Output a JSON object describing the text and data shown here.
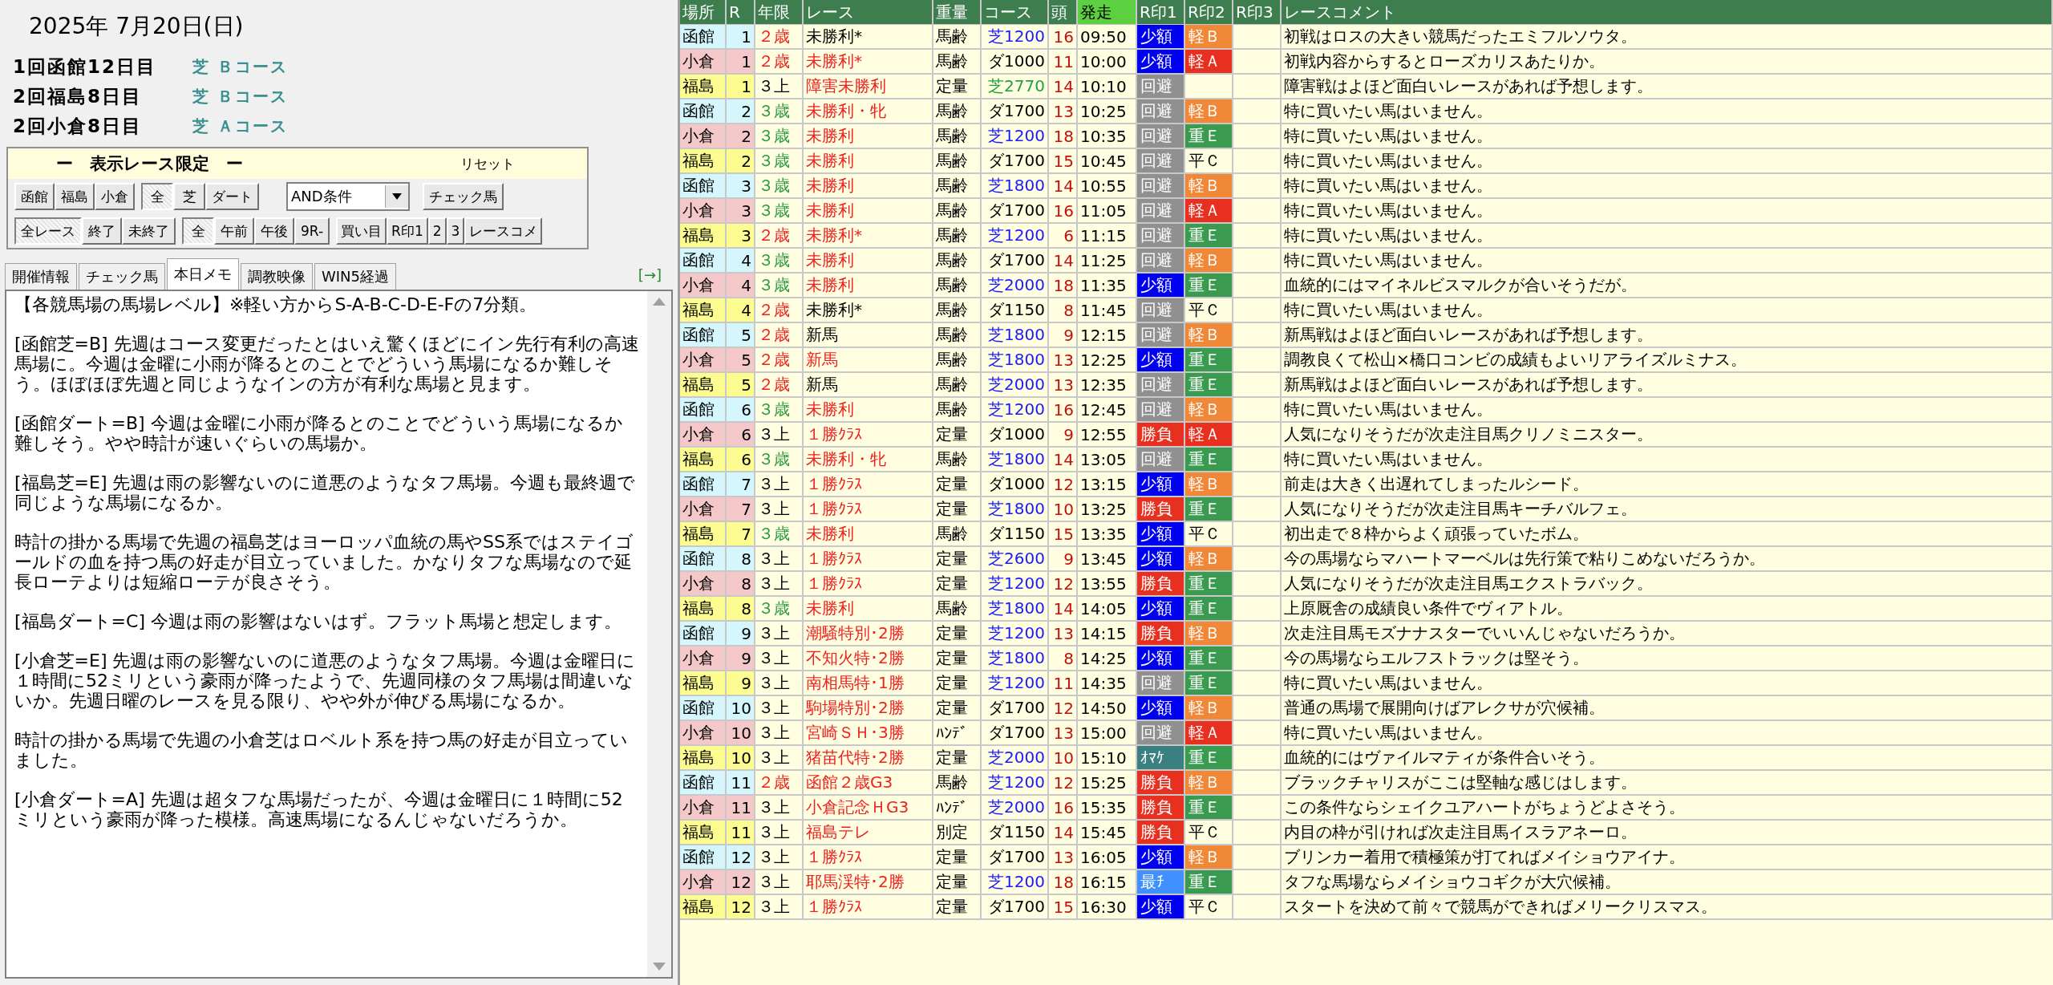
{
  "date": "2025年 7月20日(日)",
  "meetings": [
    {
      "label": "1回函館12日目",
      "course": "芝 Ｂコース"
    },
    {
      "label": "2回福島8日目",
      "course": "芝 Ｂコース"
    },
    {
      "label": "2回小倉8日目",
      "course": "芝 Ａコース"
    }
  ],
  "filter": {
    "title": "ー　表示レース限定　ー",
    "reset": "リセット",
    "row1": [
      [
        {
          "label": "函館",
          "selected": false
        },
        {
          "label": "福島",
          "selected": false
        },
        {
          "label": "小倉",
          "selected": false
        }
      ],
      [
        {
          "label": "全",
          "selected": true
        },
        {
          "label": "芝",
          "selected": false
        },
        {
          "label": "ダート",
          "selected": false
        }
      ]
    ],
    "condition": "AND条件",
    "check_button": "チェック馬",
    "row2": [
      [
        {
          "label": "全レース",
          "selected": true
        },
        {
          "label": "終了",
          "selected": false
        },
        {
          "label": "未終了",
          "selected": false
        }
      ],
      [
        {
          "label": "全",
          "selected": true
        },
        {
          "label": "午前",
          "selected": false
        },
        {
          "label": "午後",
          "selected": false
        },
        {
          "label": "9R-",
          "selected": false
        }
      ]
    ],
    "row2_buttons": [
      "買い目",
      "R印1",
      "2",
      "3",
      "レースコメ"
    ]
  },
  "tabs": [
    {
      "label": "開催情報",
      "selected": false
    },
    {
      "label": "チェック馬",
      "selected": false
    },
    {
      "label": "本日メモ",
      "selected": true
    },
    {
      "label": "調教映像",
      "selected": false
    },
    {
      "label": "WIN5経過",
      "selected": false
    }
  ],
  "expand_link": "[→]",
  "memo": [
    "【各競馬場の馬場レベル】※軽い方からS-A-B-C-D-E-Fの7分類。",
    "[函館芝=B] 先週はコース変更だったとはいえ驚くほどにイン先行有利の高速馬場に。今週は金曜に小雨が降るとのことでどういう馬場になるか難しそう。ほぼほぼ先週と同じようなインの方が有利な馬場と見ます。",
    "[函館ダート=B] 今週は金曜に小雨が降るとのことでどういう馬場になるか難しそう。やや時計が速いぐらいの馬場か。",
    "[福島芝=E] 先週は雨の影響ないのに道悪のようなタフ馬場。今週も最終週で同じような馬場になるか。",
    "時計の掛かる馬場で先週の福島芝はヨーロッパ血統の馬やSS系ではステイゴールドの血を持つ馬の好走が目立っていました。かなりタフな馬場なので延長ローテよりは短縮ローテが良さそう。",
    "[福島ダート=C] 今週は雨の影響はないはず。フラット馬場と想定します。",
    "[小倉芝=E] 先週は雨の影響ないのに道悪のようなタフ馬場。今週は金曜日に１時間に52ミリという豪雨が降ったようで、先週同様のタフ馬場は間違いないか。先週日曜のレースを見る限り、やや外が伸びる馬場になるか。",
    "時計の掛かる馬場で先週の小倉芝はロベルト系を持つ馬の好走が目立っていました。",
    "[小倉ダート=A] 先週は超タフな馬場だったが、今週は金曜日に１時間に52ミリという豪雨が降った模様。高速馬場になるんじゃないだろうか。"
  ],
  "table": {
    "columns": [
      {
        "label": "場所",
        "selected": false
      },
      {
        "label": "R",
        "selected": false
      },
      {
        "label": "年限",
        "selected": false
      },
      {
        "label": "レース",
        "selected": false
      },
      {
        "label": "重量",
        "selected": false
      },
      {
        "label": "コース",
        "selected": false
      },
      {
        "label": "頭",
        "selected": false
      },
      {
        "label": "発走",
        "selected": true
      },
      {
        "label": "R印1",
        "selected": false
      },
      {
        "label": "R印2",
        "selected": false
      },
      {
        "label": "R印3",
        "selected": false
      },
      {
        "label": "レースコメント",
        "selected": false
      }
    ],
    "rows": [
      {
        "venue": {
          "text": "函館",
          "color": "#d4f6fc"
        },
        "r": "1",
        "age": {
          "text": "２歳",
          "color": "#ee2020"
        },
        "race": {
          "text": "未勝利*",
          "color": "#000000"
        },
        "weight": "馬齢",
        "course": {
          "text": "芝1200",
          "color": "#1a1aff"
        },
        "heads": "16",
        "time": "09:50",
        "mark1": {
          "text": "少額",
          "color": "#0000f0"
        },
        "mark2": {
          "text": "軽Ｂ",
          "color": "#f08838"
        },
        "comment": "初戦はロスの大きい競馬だったエミフルソウタ。"
      },
      {
        "venue": {
          "text": "小倉",
          "color": "#f4c8c8"
        },
        "r": "1",
        "age": {
          "text": "２歳",
          "color": "#ee2020"
        },
        "race": {
          "text": "未勝利*",
          "color": "#ee2020"
        },
        "weight": "馬齢",
        "course": {
          "text": "ダ1000",
          "color": "#000000"
        },
        "heads": "11",
        "time": "10:00",
        "mark1": {
          "text": "少額",
          "color": "#0000f0"
        },
        "mark2": {
          "text": "軽Ａ",
          "color": "#e83020"
        },
        "comment": "初戦内容からするとローズカリスあたりか。"
      },
      {
        "venue": {
          "text": "福島",
          "color": "#fcfc90"
        },
        "r": "1",
        "age": {
          "text": "３上",
          "color": "#000000"
        },
        "race": {
          "text": "障害未勝利",
          "color": "#ee2020"
        },
        "weight": "定量",
        "course": {
          "text": "芝2770",
          "color": "#20a040"
        },
        "heads": "14",
        "time": "10:10",
        "mark1": {
          "text": "回避",
          "color": "#909090"
        },
        "comment": "障害戦はよほど面白いレースがあれば予想します。"
      },
      {
        "venue": {
          "text": "函館",
          "color": "#d4f6fc"
        },
        "r": "2",
        "age": {
          "text": "３歳",
          "color": "#2a9a40"
        },
        "race": {
          "text": "未勝利・牝",
          "color": "#ee2020"
        },
        "weight": "馬齢",
        "course": {
          "text": "ダ1700",
          "color": "#000000"
        },
        "heads": "13",
        "time": "10:25",
        "mark1": {
          "text": "回避",
          "color": "#909090"
        },
        "mark2": {
          "text": "軽Ｂ",
          "color": "#f08838"
        },
        "comment": "特に買いたい馬はいません。"
      },
      {
        "venue": {
          "text": "小倉",
          "color": "#f4c8c8"
        },
        "r": "2",
        "age": {
          "text": "３歳",
          "color": "#2a9a40"
        },
        "race": {
          "text": "未勝利",
          "color": "#ee2020"
        },
        "weight": "馬齢",
        "course": {
          "text": "芝1200",
          "color": "#1a1aff"
        },
        "heads": "18",
        "time": "10:35",
        "mark1": {
          "text": "回避",
          "color": "#909090"
        },
        "mark2": {
          "text": "重Ｅ",
          "color": "#3a9a50"
        },
        "comment": "特に買いたい馬はいません。"
      },
      {
        "venue": {
          "text": "福島",
          "color": "#fcfc90"
        },
        "r": "2",
        "age": {
          "text": "３歳",
          "color": "#2a9a40"
        },
        "race": {
          "text": "未勝利",
          "color": "#ee2020"
        },
        "weight": "馬齢",
        "course": {
          "text": "ダ1700",
          "color": "#000000"
        },
        "heads": "15",
        "time": "10:45",
        "mark1": {
          "text": "回避",
          "color": "#909090"
        },
        "mark2": {
          "text": "平Ｃ"
        },
        "comment": "特に買いたい馬はいません。"
      },
      {
        "venue": {
          "text": "函館",
          "color": "#d4f6fc"
        },
        "r": "3",
        "age": {
          "text": "３歳",
          "color": "#2a9a40"
        },
        "race": {
          "text": "未勝利",
          "color": "#ee2020"
        },
        "weight": "馬齢",
        "course": {
          "text": "芝1800",
          "color": "#1a1aff"
        },
        "heads": "14",
        "time": "10:55",
        "mark1": {
          "text": "回避",
          "color": "#909090"
        },
        "mark2": {
          "text": "軽Ｂ",
          "color": "#f08838"
        },
        "comment": "特に買いたい馬はいません。"
      },
      {
        "venue": {
          "text": "小倉",
          "color": "#f4c8c8"
        },
        "r": "3",
        "age": {
          "text": "３歳",
          "color": "#2a9a40"
        },
        "race": {
          "text": "未勝利",
          "color": "#ee2020"
        },
        "weight": "馬齢",
        "course": {
          "text": "ダ1700",
          "color": "#000000"
        },
        "heads": "16",
        "time": "11:05",
        "mark1": {
          "text": "回避",
          "color": "#909090"
        },
        "mark2": {
          "text": "軽Ａ",
          "color": "#e83020"
        },
        "comment": "特に買いたい馬はいません。"
      },
      {
        "venue": {
          "text": "福島",
          "color": "#fcfc90"
        },
        "r": "3",
        "age": {
          "text": "２歳",
          "color": "#ee2020"
        },
        "race": {
          "text": "未勝利*",
          "color": "#ee2020"
        },
        "weight": "馬齢",
        "course": {
          "text": "芝1200",
          "color": "#1a1aff"
        },
        "heads": "6",
        "time": "11:15",
        "mark1": {
          "text": "回避",
          "color": "#909090"
        },
        "mark2": {
          "text": "重Ｅ",
          "color": "#3a9a50"
        },
        "comment": "特に買いたい馬はいません。"
      },
      {
        "venue": {
          "text": "函館",
          "color": "#d4f6fc"
        },
        "r": "4",
        "age": {
          "text": "３歳",
          "color": "#2a9a40"
        },
        "race": {
          "text": "未勝利",
          "color": "#ee2020"
        },
        "weight": "馬齢",
        "course": {
          "text": "ダ1700",
          "color": "#000000"
        },
        "heads": "14",
        "time": "11:25",
        "mark1": {
          "text": "回避",
          "color": "#909090"
        },
        "mark2": {
          "text": "軽Ｂ",
          "color": "#f08838"
        },
        "comment": "特に買いたい馬はいません。"
      },
      {
        "venue": {
          "text": "小倉",
          "color": "#f4c8c8"
        },
        "r": "4",
        "age": {
          "text": "３歳",
          "color": "#2a9a40"
        },
        "race": {
          "text": "未勝利",
          "color": "#ee2020"
        },
        "weight": "馬齢",
        "course": {
          "text": "芝2000",
          "color": "#1a1aff"
        },
        "heads": "18",
        "time": "11:35",
        "mark1": {
          "text": "少額",
          "color": "#0000f0"
        },
        "mark2": {
          "text": "重Ｅ",
          "color": "#3a9a50"
        },
        "comment": "血統的にはマイネルビスマルクが合いそうだが。"
      },
      {
        "venue": {
          "text": "福島",
          "color": "#fcfc90"
        },
        "r": "4",
        "age": {
          "text": "２歳",
          "color": "#ee2020"
        },
        "race": {
          "text": "未勝利*",
          "color": "#000000"
        },
        "weight": "馬齢",
        "course": {
          "text": "ダ1150",
          "color": "#000000"
        },
        "heads": "8",
        "time": "11:45",
        "mark1": {
          "text": "回避",
          "color": "#909090"
        },
        "mark2": {
          "text": "平Ｃ"
        },
        "comment": "特に買いたい馬はいません。"
      },
      {
        "venue": {
          "text": "函館",
          "color": "#d4f6fc"
        },
        "r": "5",
        "age": {
          "text": "２歳",
          "color": "#ee2020"
        },
        "race": {
          "text": "新馬",
          "color": "#000000"
        },
        "weight": "馬齢",
        "course": {
          "text": "芝1800",
          "color": "#1a1aff"
        },
        "heads": "9",
        "time": "12:15",
        "mark1": {
          "text": "回避",
          "color": "#909090"
        },
        "mark2": {
          "text": "軽Ｂ",
          "color": "#f08838"
        },
        "comment": "新馬戦はよほど面白いレースがあれば予想します。"
      },
      {
        "venue": {
          "text": "小倉",
          "color": "#f4c8c8"
        },
        "r": "5",
        "age": {
          "text": "２歳",
          "color": "#ee2020"
        },
        "race": {
          "text": "新馬",
          "color": "#ee2020"
        },
        "weight": "馬齢",
        "course": {
          "text": "芝1800",
          "color": "#1a1aff"
        },
        "heads": "13",
        "time": "12:25",
        "mark1": {
          "text": "少額",
          "color": "#0000f0"
        },
        "mark2": {
          "text": "重Ｅ",
          "color": "#3a9a50"
        },
        "comment": "調教良くて松山×橋口コンビの成績もよいリアライズルミナス。"
      },
      {
        "venue": {
          "text": "福島",
          "color": "#fcfc90"
        },
        "r": "5",
        "age": {
          "text": "２歳",
          "color": "#ee2020"
        },
        "race": {
          "text": "新馬",
          "color": "#000000"
        },
        "weight": "馬齢",
        "course": {
          "text": "芝2000",
          "color": "#1a1aff"
        },
        "heads": "13",
        "time": "12:35",
        "mark1": {
          "text": "回避",
          "color": "#909090"
        },
        "mark2": {
          "text": "重Ｅ",
          "color": "#3a9a50"
        },
        "comment": "新馬戦はよほど面白いレースがあれば予想します。"
      },
      {
        "venue": {
          "text": "函館",
          "color": "#d4f6fc"
        },
        "r": "6",
        "age": {
          "text": "３歳",
          "color": "#2a9a40"
        },
        "race": {
          "text": "未勝利",
          "color": "#ee2020"
        },
        "weight": "馬齢",
        "course": {
          "text": "芝1200",
          "color": "#1a1aff"
        },
        "heads": "16",
        "time": "12:45",
        "mark1": {
          "text": "回避",
          "color": "#909090"
        },
        "mark2": {
          "text": "軽Ｂ",
          "color": "#f08838"
        },
        "comment": "特に買いたい馬はいません。"
      },
      {
        "venue": {
          "text": "小倉",
          "color": "#f4c8c8"
        },
        "r": "6",
        "age": {
          "text": "３上",
          "color": "#000000"
        },
        "race": {
          "text": "１勝ｸﾗｽ",
          "color": "#ee2020"
        },
        "weight": "定量",
        "course": {
          "text": "ダ1000",
          "color": "#000000"
        },
        "heads": "9",
        "time": "12:55",
        "mark1": {
          "text": "勝負",
          "color": "#e83020"
        },
        "mark2": {
          "text": "軽Ａ",
          "color": "#e83020"
        },
        "comment": "人気になりそうだが次走注目馬クリノミニスター。"
      },
      {
        "venue": {
          "text": "福島",
          "color": "#fcfc90"
        },
        "r": "6",
        "age": {
          "text": "３歳",
          "color": "#2a9a40"
        },
        "race": {
          "text": "未勝利・牝",
          "color": "#ee2020"
        },
        "weight": "馬齢",
        "course": {
          "text": "芝1800",
          "color": "#1a1aff"
        },
        "heads": "14",
        "time": "13:05",
        "mark1": {
          "text": "回避",
          "color": "#909090"
        },
        "mark2": {
          "text": "重Ｅ",
          "color": "#3a9a50"
        },
        "comment": "特に買いたい馬はいません。"
      },
      {
        "venue": {
          "text": "函館",
          "color": "#d4f6fc"
        },
        "r": "7",
        "age": {
          "text": "３上",
          "color": "#000000"
        },
        "race": {
          "text": "１勝ｸﾗｽ",
          "color": "#ee2020"
        },
        "weight": "定量",
        "course": {
          "text": "ダ1000",
          "color": "#000000"
        },
        "heads": "12",
        "time": "13:15",
        "mark1": {
          "text": "少額",
          "color": "#0000f0"
        },
        "mark2": {
          "text": "軽Ｂ",
          "color": "#f08838"
        },
        "comment": "前走は大きく出遅れてしまったルシード。"
      },
      {
        "venue": {
          "text": "小倉",
          "color": "#f4c8c8"
        },
        "r": "7",
        "age": {
          "text": "３上",
          "color": "#000000"
        },
        "race": {
          "text": "１勝ｸﾗｽ",
          "color": "#ee2020"
        },
        "weight": "定量",
        "course": {
          "text": "芝1800",
          "color": "#1a1aff"
        },
        "heads": "10",
        "time": "13:25",
        "mark1": {
          "text": "勝負",
          "color": "#e83020"
        },
        "mark2": {
          "text": "重Ｅ",
          "color": "#3a9a50"
        },
        "comment": "人気になりそうだが次走注目馬キーチバルフェ。"
      },
      {
        "venue": {
          "text": "福島",
          "color": "#fcfc90"
        },
        "r": "7",
        "age": {
          "text": "３歳",
          "color": "#2a9a40"
        },
        "race": {
          "text": "未勝利",
          "color": "#ee2020"
        },
        "weight": "馬齢",
        "course": {
          "text": "ダ1150",
          "color": "#000000"
        },
        "heads": "15",
        "time": "13:35",
        "mark1": {
          "text": "少額",
          "color": "#0000f0"
        },
        "mark2": {
          "text": "平Ｃ"
        },
        "comment": "初出走で８枠からよく頑張っていたボム。"
      },
      {
        "venue": {
          "text": "函館",
          "color": "#d4f6fc"
        },
        "r": "8",
        "age": {
          "text": "３上",
          "color": "#000000"
        },
        "race": {
          "text": "１勝ｸﾗｽ",
          "color": "#ee2020"
        },
        "weight": "定量",
        "course": {
          "text": "芝2600",
          "color": "#1a1aff"
        },
        "heads": "9",
        "time": "13:45",
        "mark1": {
          "text": "少額",
          "color": "#0000f0"
        },
        "mark2": {
          "text": "軽Ｂ",
          "color": "#f08838"
        },
        "comment": "今の馬場ならマハートマーベルは先行策で粘りこめないだろうか。"
      },
      {
        "venue": {
          "text": "小倉",
          "color": "#f4c8c8"
        },
        "r": "8",
        "age": {
          "text": "３上",
          "color": "#000000"
        },
        "race": {
          "text": "１勝ｸﾗｽ",
          "color": "#ee2020"
        },
        "weight": "定量",
        "course": {
          "text": "芝1200",
          "color": "#1a1aff"
        },
        "heads": "12",
        "time": "13:55",
        "mark1": {
          "text": "勝負",
          "color": "#e83020"
        },
        "mark2": {
          "text": "重Ｅ",
          "color": "#3a9a50"
        },
        "comment": "人気になりそうだが次走注目馬エクストラバック。"
      },
      {
        "venue": {
          "text": "福島",
          "color": "#fcfc90"
        },
        "r": "8",
        "age": {
          "text": "３歳",
          "color": "#2a9a40"
        },
        "race": {
          "text": "未勝利",
          "color": "#ee2020"
        },
        "weight": "馬齢",
        "course": {
          "text": "芝1800",
          "color": "#1a1aff"
        },
        "heads": "14",
        "time": "14:05",
        "mark1": {
          "text": "少額",
          "color": "#0000f0"
        },
        "mark2": {
          "text": "重Ｅ",
          "color": "#3a9a50"
        },
        "comment": "上原厩舎の成績良い条件でヴィアトル。"
      },
      {
        "venue": {
          "text": "函館",
          "color": "#d4f6fc"
        },
        "r": "9",
        "age": {
          "text": "３上",
          "color": "#000000"
        },
        "race": {
          "text": "潮騒特別･2勝",
          "color": "#ee2020"
        },
        "weight": "定量",
        "course": {
          "text": "芝1200",
          "color": "#1a1aff"
        },
        "heads": "13",
        "time": "14:15",
        "mark1": {
          "text": "勝負",
          "color": "#e83020"
        },
        "mark2": {
          "text": "軽Ｂ",
          "color": "#f08838"
        },
        "comment": "次走注目馬モズナナスターでいいんじゃないだろうか。"
      },
      {
        "venue": {
          "text": "小倉",
          "color": "#f4c8c8"
        },
        "r": "9",
        "age": {
          "text": "３上",
          "color": "#000000"
        },
        "race": {
          "text": "不知火特･2勝",
          "color": "#ee2020"
        },
        "weight": "定量",
        "course": {
          "text": "芝1800",
          "color": "#1a1aff"
        },
        "heads": "8",
        "time": "14:25",
        "mark1": {
          "text": "少額",
          "color": "#0000f0"
        },
        "mark2": {
          "text": "重Ｅ",
          "color": "#3a9a50"
        },
        "comment": "今の馬場ならエルフストラックは堅そう。"
      },
      {
        "venue": {
          "text": "福島",
          "color": "#fcfc90"
        },
        "r": "9",
        "age": {
          "text": "３上",
          "color": "#000000"
        },
        "race": {
          "text": "南相馬特･1勝",
          "color": "#ee2020"
        },
        "weight": "定量",
        "course": {
          "text": "芝1200",
          "color": "#1a1aff"
        },
        "heads": "11",
        "time": "14:35",
        "mark1": {
          "text": "回避",
          "color": "#909090"
        },
        "mark2": {
          "text": "重Ｅ",
          "color": "#3a9a50"
        },
        "comment": "特に買いたい馬はいません。"
      },
      {
        "venue": {
          "text": "函館",
          "color": "#d4f6fc"
        },
        "r": "10",
        "age": {
          "text": "３上",
          "color": "#000000"
        },
        "race": {
          "text": "駒場特別･2勝",
          "color": "#ee2020"
        },
        "weight": "定量",
        "course": {
          "text": "ダ1700",
          "color": "#000000"
        },
        "heads": "12",
        "time": "14:50",
        "mark1": {
          "text": "少額",
          "color": "#0000f0"
        },
        "mark2": {
          "text": "軽Ｂ",
          "color": "#f08838"
        },
        "comment": "普通の馬場で展開向けばアレクサが穴候補。"
      },
      {
        "venue": {
          "text": "小倉",
          "color": "#f4c8c8"
        },
        "r": "10",
        "age": {
          "text": "３上",
          "color": "#000000"
        },
        "race": {
          "text": "宮崎ＳＨ･3勝",
          "color": "#ee2020"
        },
        "weight": "ﾊﾝﾃﾞ",
        "course": {
          "text": "ダ1700",
          "color": "#000000"
        },
        "heads": "13",
        "time": "15:00",
        "mark1": {
          "text": "回避",
          "color": "#909090"
        },
        "mark2": {
          "text": "軽Ａ",
          "color": "#e83020"
        },
        "comment": "特に買いたい馬はいません。"
      },
      {
        "venue": {
          "text": "福島",
          "color": "#fcfc90"
        },
        "r": "10",
        "age": {
          "text": "３上",
          "color": "#000000"
        },
        "race": {
          "text": "猪苗代特･2勝",
          "color": "#ee2020"
        },
        "weight": "定量",
        "course": {
          "text": "芝2000",
          "color": "#1a1aff"
        },
        "heads": "10",
        "time": "15:10",
        "mark1": {
          "text": "ｵﾏｹ",
          "color": "#3a8080"
        },
        "mark2": {
          "text": "重Ｅ",
          "color": "#3a9a50"
        },
        "comment": "血統的にはヴァイルマティが条件合いそう。"
      },
      {
        "venue": {
          "text": "函館",
          "color": "#d4f6fc"
        },
        "r": "11",
        "age": {
          "text": "２歳",
          "color": "#ee2020"
        },
        "race": {
          "text": "函館２歳G3",
          "color": "#ee2020"
        },
        "weight": "馬齢",
        "course": {
          "text": "芝1200",
          "color": "#1a1aff"
        },
        "heads": "12",
        "time": "15:25",
        "mark1": {
          "text": "勝負",
          "color": "#e83020"
        },
        "mark2": {
          "text": "軽Ｂ",
          "color": "#f08838"
        },
        "comment": "ブラックチャリスがここは堅軸な感じはします。"
      },
      {
        "venue": {
          "text": "小倉",
          "color": "#f4c8c8"
        },
        "r": "11",
        "age": {
          "text": "３上",
          "color": "#000000"
        },
        "race": {
          "text": "小倉記念ＨG3",
          "color": "#ee2020"
        },
        "weight": "ﾊﾝﾃﾞ",
        "course": {
          "text": "芝2000",
          "color": "#1a1aff"
        },
        "heads": "16",
        "time": "15:35",
        "mark1": {
          "text": "勝負",
          "color": "#e83020"
        },
        "mark2": {
          "text": "重Ｅ",
          "color": "#3a9a50"
        },
        "comment": "この条件ならシェイクユアハートがちょうどよさそう。"
      },
      {
        "venue": {
          "text": "福島",
          "color": "#fcfc90"
        },
        "r": "11",
        "age": {
          "text": "３上",
          "color": "#000000"
        },
        "race": {
          "text": "福島テレ",
          "color": "#ee2020"
        },
        "weight": "別定",
        "course": {
          "text": "ダ1150",
          "color": "#000000"
        },
        "heads": "14",
        "time": "15:45",
        "mark1": {
          "text": "勝負",
          "color": "#e83020"
        },
        "mark2": {
          "text": "平Ｃ"
        },
        "comment": "内目の枠が引ければ次走注目馬イスラアネーロ。"
      },
      {
        "venue": {
          "text": "函館",
          "color": "#d4f6fc"
        },
        "r": "12",
        "age": {
          "text": "３上",
          "color": "#000000"
        },
        "race": {
          "text": "１勝ｸﾗｽ",
          "color": "#ee2020"
        },
        "weight": "定量",
        "course": {
          "text": "ダ1700",
          "color": "#000000"
        },
        "heads": "13",
        "time": "16:05",
        "mark1": {
          "text": "少額",
          "color": "#0000f0"
        },
        "mark2": {
          "text": "軽Ｂ",
          "color": "#f08838"
        },
        "comment": "ブリンカー着用で積極策が打てればメイショウアイナ。"
      },
      {
        "venue": {
          "text": "小倉",
          "color": "#f4c8c8"
        },
        "r": "12",
        "age": {
          "text": "３上",
          "color": "#000000"
        },
        "race": {
          "text": "耶馬渓特･2勝",
          "color": "#ee2020"
        },
        "weight": "定量",
        "course": {
          "text": "芝1200",
          "color": "#1a1aff"
        },
        "heads": "18",
        "time": "16:15",
        "mark1": {
          "text": "最ﾁ",
          "color": "#4090ff"
        },
        "mark2": {
          "text": "重Ｅ",
          "color": "#3a9a50"
        },
        "comment": "タフな馬場ならメイショウコギクが大穴候補。"
      },
      {
        "venue": {
          "text": "福島",
          "color": "#fcfc90"
        },
        "r": "12",
        "age": {
          "text": "３上",
          "color": "#000000"
        },
        "race": {
          "text": "１勝ｸﾗｽ",
          "color": "#ee2020"
        },
        "weight": "定量",
        "course": {
          "text": "ダ1700",
          "color": "#000000"
        },
        "heads": "15",
        "time": "16:30",
        "mark1": {
          "text": "少額",
          "color": "#0000f0"
        },
        "mark2": {
          "text": "平Ｃ"
        },
        "comment": "スタートを決めて前々で競馬ができればメリークリスマス。"
      }
    ]
  }
}
